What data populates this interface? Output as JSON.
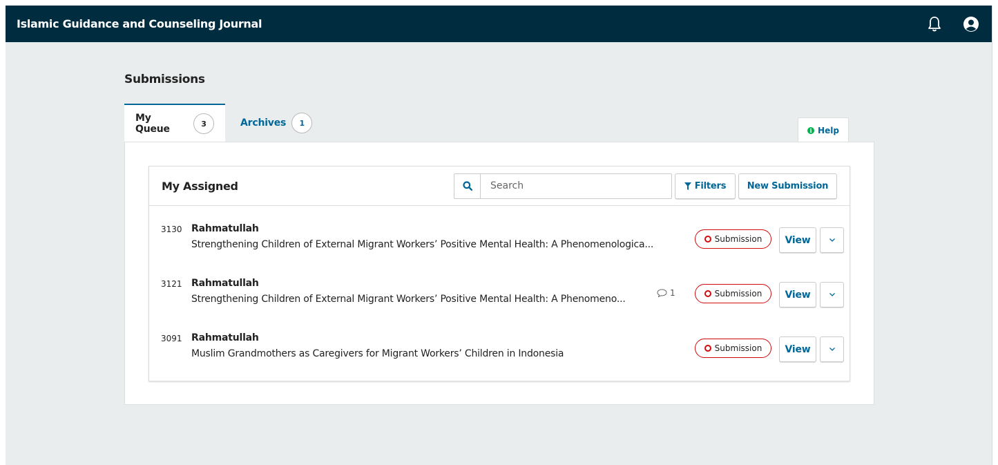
{
  "header": {
    "site_title": "Islamic Guidance and Counseling Journal",
    "notification_icon": "bell-icon",
    "user_icon": "user-circle-icon"
  },
  "page": {
    "title": "Submissions"
  },
  "tabs": [
    {
      "label": "My Queue",
      "count": "3",
      "active": true
    },
    {
      "label": "Archives",
      "count": "1",
      "active": false
    }
  ],
  "help": {
    "label": "Help",
    "icon": "info-icon"
  },
  "list": {
    "title": "My Assigned",
    "search": {
      "placeholder": "Search",
      "value": ""
    },
    "filters_label": "Filters",
    "new_submission_label": "New Submission",
    "items": [
      {
        "id": "3130",
        "author": "Rahmatullah",
        "title": "Strengthening Children of External Migrant Workers’ Positive Mental Health: A Phenomenologica...",
        "comments": "",
        "stage": "Submission",
        "view_label": "View"
      },
      {
        "id": "3121",
        "author": "Rahmatullah",
        "title": "Strengthening Children of External Migrant Workers’ Positive Mental Health: A Phenomeno...",
        "comments": "1",
        "stage": "Submission",
        "view_label": "View"
      },
      {
        "id": "3091",
        "author": "Rahmatullah",
        "title": "Muslim Grandmothers as Caregivers for Migrant Workers’ Children in Indonesia",
        "comments": "",
        "stage": "Submission",
        "view_label": "View"
      }
    ]
  },
  "colors": {
    "header_bg": "#002c40",
    "accent": "#006798",
    "stage_red": "#d00a0a",
    "help_green": "#00b24e"
  }
}
